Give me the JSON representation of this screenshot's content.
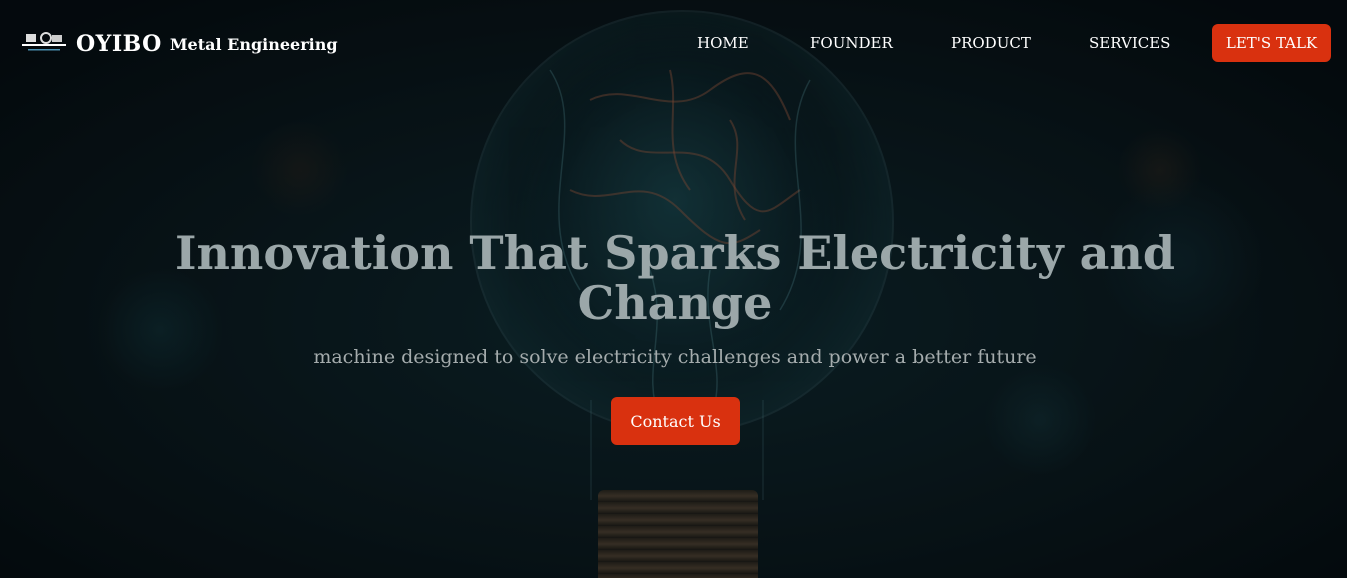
{
  "navbar": {
    "brand_name": "OYIBO",
    "brand_subtitle": "Metal Engineering",
    "links": [
      {
        "label": "HOME"
      },
      {
        "label": "FOUNDER"
      },
      {
        "label": "PRODUCT"
      },
      {
        "label": "SERVICES"
      }
    ],
    "cta_label": "LET'S TALK"
  },
  "hero": {
    "title": "Innovation That Sparks Electricity and Change",
    "subtitle": "machine designed to solve electricity challenges and power a better future",
    "button_label": "Contact Us"
  },
  "colors": {
    "accent": "#d9310f",
    "nav_text": "#ffffff",
    "title_text": "#9ba7a9"
  },
  "icons": {
    "logo": "company-logo-icon",
    "background": "lightbulb-electricity-image"
  }
}
